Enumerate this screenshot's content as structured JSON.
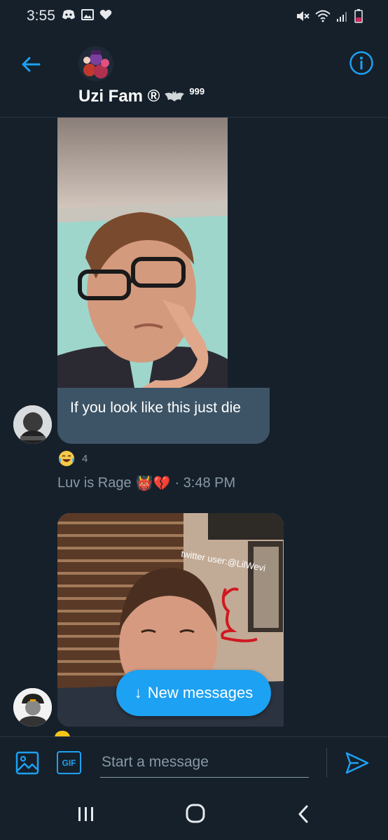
{
  "status_bar": {
    "time": "3:55"
  },
  "header": {
    "group_name": "Uzi Fam ®",
    "group_name_suffix": "999"
  },
  "messages": [
    {
      "text": "If you look like this just die",
      "reaction_emoji": "😂",
      "reaction_count": "4",
      "sender": "Luv is Rage",
      "sender_emoji": "👹💔",
      "time": "· 3:48 PM"
    }
  ],
  "second_photo": {
    "watermark": "twitter user:@LilWevi"
  },
  "new_messages_pill": {
    "arrow": "↓",
    "label": "New messages"
  },
  "composer": {
    "gif_label": "GIF",
    "placeholder": "Start a message"
  },
  "colors": {
    "background": "#15202b",
    "accent": "#1da1f2",
    "bubble": "#3d5466",
    "muted_text": "#8899a6"
  },
  "icons": {
    "back": "back-arrow-icon",
    "info": "info-icon",
    "image": "image-icon",
    "gif": "gif-icon",
    "send": "send-icon"
  }
}
